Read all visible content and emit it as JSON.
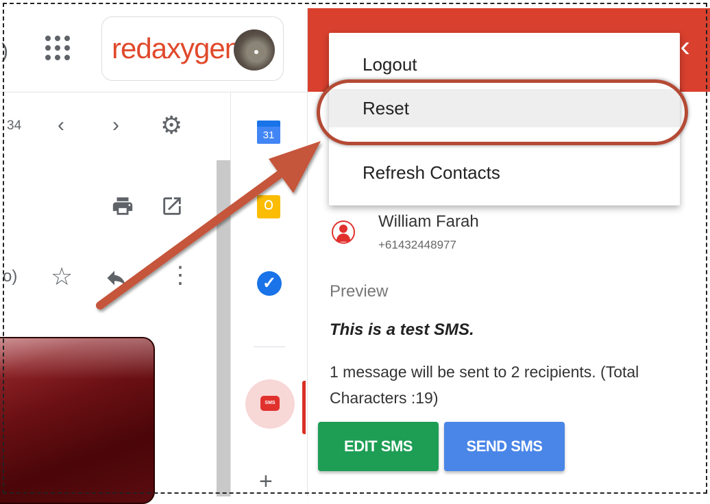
{
  "gmail": {
    "count_text": "34",
    "partial_text": "o)",
    "apps_icon": "apps-grid-icon",
    "brand": "redaxygen"
  },
  "sidebar_apps": {
    "calendar_day": "31",
    "sms_badge": "SMS",
    "add_label": "+"
  },
  "menu": {
    "items": [
      "Logout",
      "Reset",
      "Refresh Contacts"
    ]
  },
  "contact": {
    "name": "William Farah",
    "phone": "+61432448977"
  },
  "preview": {
    "label": "Preview",
    "message": "This is a test SMS.",
    "summary": "1  message will be sent to 2  recipients. (Total Characters :19)"
  },
  "buttons": {
    "edit": "EDIT SMS",
    "send": "SEND SMS"
  },
  "colors": {
    "header_red": "#d9402e",
    "annotation": "#b44a35",
    "edit_green": "#1e9e55",
    "send_blue": "#4a86e8"
  }
}
